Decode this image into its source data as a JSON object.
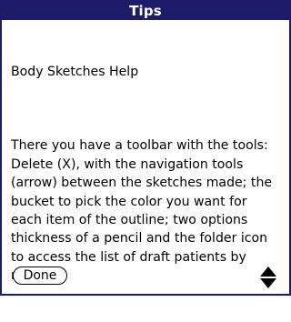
{
  "dialog": {
    "title": "Tips"
  },
  "content": {
    "subtitle": "Body Sketches Help",
    "text": "There you have a toolbar with the tools:\nDelete (X), with the navigation tools (arrow) between the sketches made; the bucket to pick the color you want for each item of the outline; two options thickness of a pencil and the folder icon to access the list of draft patients by name."
  },
  "footer": {
    "done_label": "Done"
  },
  "colors": {
    "titlebar": "#1c1c6b",
    "title_text": "#ffffff",
    "background": "#ffffff",
    "text": "#000000"
  },
  "icons": {
    "scroll_up": "triangle-up",
    "scroll_down": "triangle-down"
  }
}
